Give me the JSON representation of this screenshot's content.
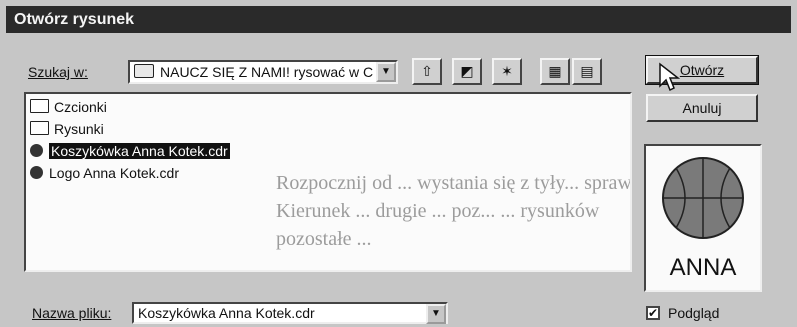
{
  "dialog": {
    "title": "Otwórz rysunek"
  },
  "lookin": {
    "label": "Szukaj w:",
    "value": "NAUCZ SIĘ Z NAMI! rysować w C"
  },
  "toolbar": {
    "icons": [
      "up-folder-icon",
      "desktop-icon",
      "new-folder-icon",
      "list-view-icon",
      "details-view-icon"
    ]
  },
  "files": [
    {
      "name": "Czcionki",
      "kind": "folder",
      "selected": false
    },
    {
      "name": "Rysunki",
      "kind": "folder",
      "selected": false
    },
    {
      "name": "Koszykówka Anna Kotek.cdr",
      "kind": "cdr",
      "selected": true
    },
    {
      "name": "Logo Anna Kotek.cdr",
      "kind": "cdr",
      "selected": false
    }
  ],
  "background_text": [
    "Rozpocznij od ... wystania się z tyły... sprawdź nazwy ... Kliknięcie",
    "Kierunek ... drugie ... poz... ... rysunków",
    "pozostałe ..."
  ],
  "buttons": {
    "open": "Otwórz",
    "cancel": "Anuluj"
  },
  "preview": {
    "caption": "ANNA"
  },
  "filename": {
    "label": "Nazwa pliku:",
    "value": "Koszykówka Anna Kotek.cdr"
  },
  "preview_toggle": {
    "label": "Podgląd",
    "checked": true
  }
}
